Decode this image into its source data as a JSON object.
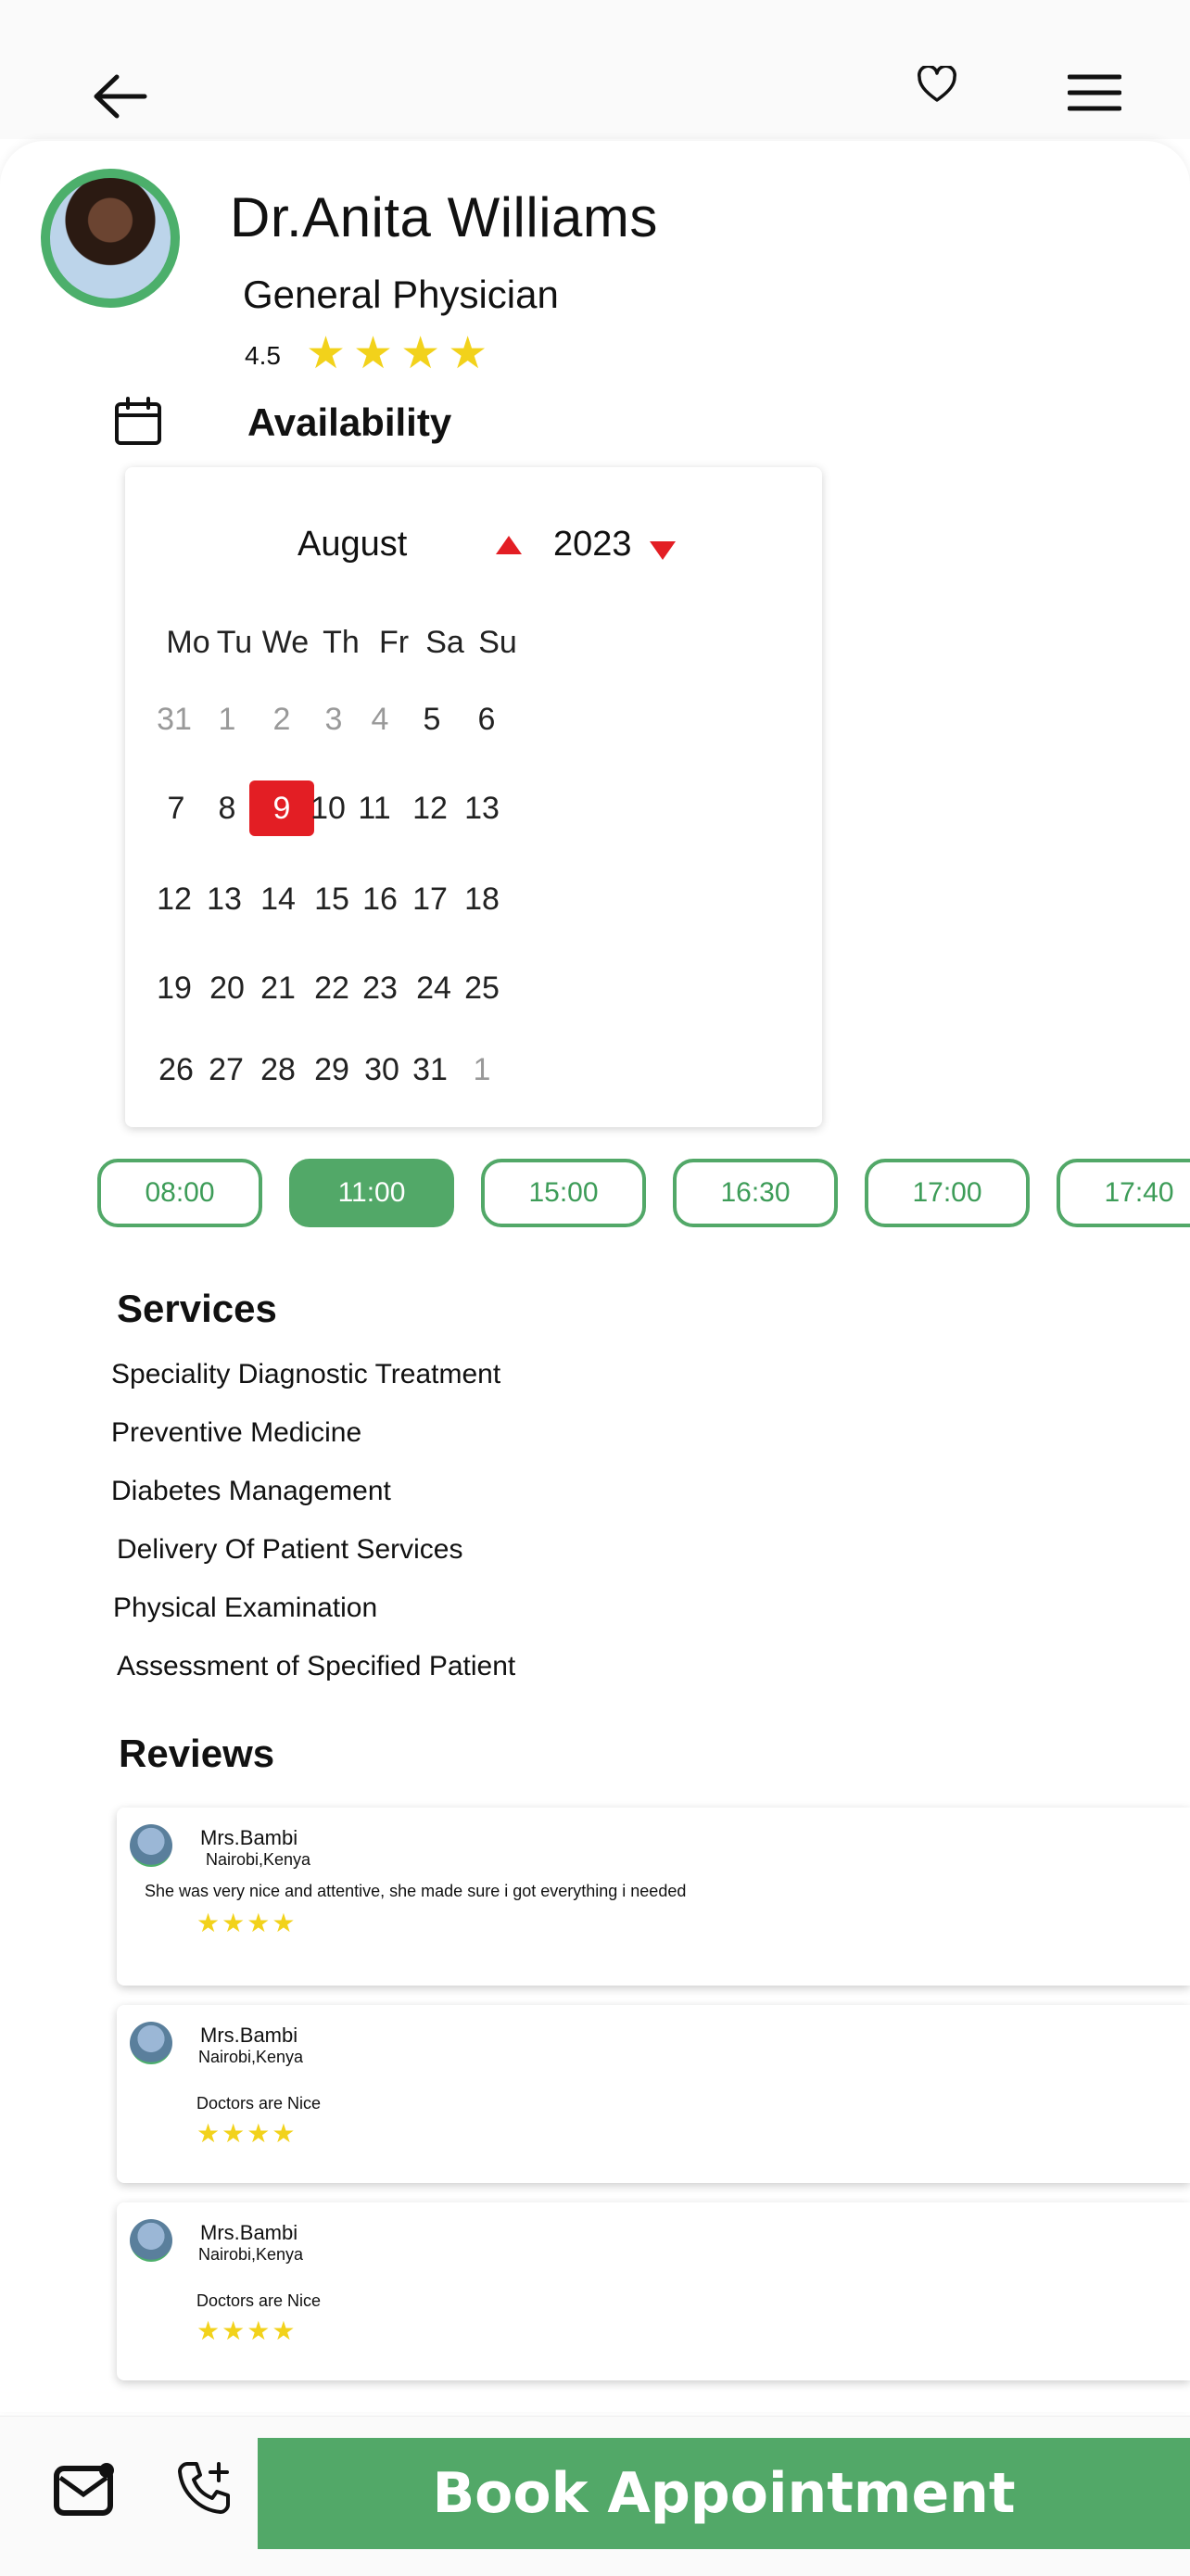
{
  "doctor": {
    "name": "Dr.Anita Williams",
    "specialty": "General Physician",
    "rating": "4.5",
    "stars": 4
  },
  "availability": {
    "label": "Availability",
    "month": "August",
    "year": "2023",
    "weekdays": [
      "Mo",
      "Tu",
      "We",
      "Th",
      "Fr",
      "Sa",
      "Su"
    ],
    "weeks": [
      [
        "31",
        "1",
        "2",
        "3",
        "4",
        "5",
        "6"
      ],
      [
        "7",
        "8",
        "9",
        "10",
        "11",
        "12",
        "13"
      ],
      [
        "12",
        "13",
        "14",
        "15",
        "16",
        "17",
        "18"
      ],
      [
        "19",
        "20",
        "21",
        "22",
        "23",
        "24",
        "25"
      ],
      [
        "26",
        "27",
        "28",
        "29",
        "30",
        "31",
        "1"
      ]
    ],
    "selected_day": "9"
  },
  "time_slots": [
    {
      "label": "08:00",
      "active": false
    },
    {
      "label": "11:00",
      "active": true
    },
    {
      "label": "15:00",
      "active": false
    },
    {
      "label": "16:30",
      "active": false
    },
    {
      "label": "17:00",
      "active": false
    },
    {
      "label": "17:40",
      "active": false
    }
  ],
  "services": {
    "title": "Services",
    "items": [
      "Speciality Diagnostic Treatment",
      "Preventive Medicine",
      "Diabetes Management",
      "Delivery Of Patient Services",
      "Physical Examination",
      "Assessment of Specified Patient"
    ]
  },
  "reviews": {
    "title": "Reviews",
    "items": [
      {
        "name": "Mrs.Bambi",
        "location": "Nairobi,Kenya",
        "text": "She was very nice and attentive, she made sure i got everything i needed",
        "stars": 4
      },
      {
        "name": "Mrs.Bambi",
        "location": "Nairobi,Kenya",
        "text": "Doctors are Nice",
        "stars": 4
      },
      {
        "name": "Mrs.Bambi",
        "location": "Nairobi,Kenya",
        "text": "Doctors are Nice",
        "stars": 4
      }
    ]
  },
  "actions": {
    "book_label": "Book Appointment"
  },
  "icons": {
    "back": "arrow-left-icon",
    "favorite": "heart-icon",
    "menu": "hamburger-menu-icon",
    "calendar": "calendar-icon",
    "mail": "mail-icon",
    "call": "phone-add-icon"
  },
  "colors": {
    "accent_green": "#52a868",
    "selected_red": "#e31e24",
    "star_yellow": "#f2d21b"
  }
}
